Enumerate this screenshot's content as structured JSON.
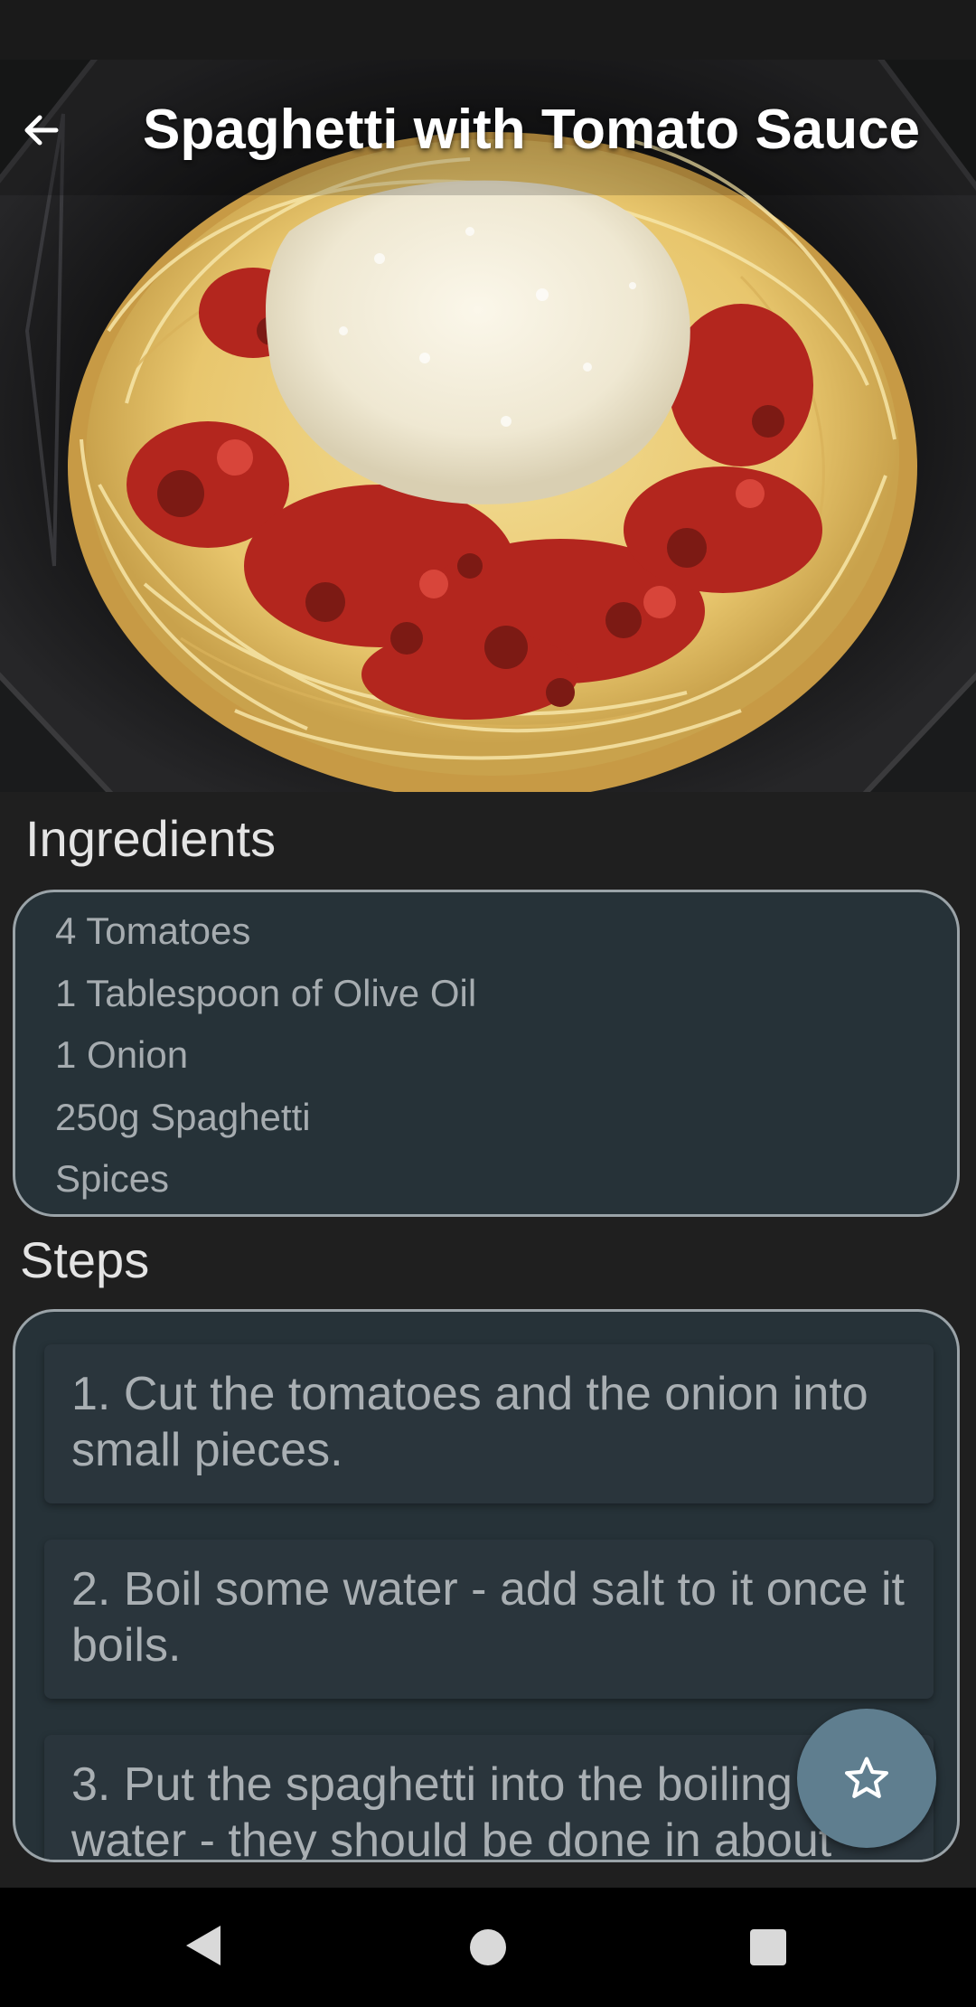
{
  "app": {
    "title": "Spaghetti with Tomato Sauce"
  },
  "icons": {
    "back": "arrow-left-icon",
    "favorite": "star-outline-icon",
    "nav_back": "triangle-back-icon",
    "nav_home": "circle-home-icon",
    "nav_recents": "square-recents-icon"
  },
  "ingredients": {
    "title": "Ingredients",
    "items": [
      "4 Tomatoes",
      "1 Tablespoon of Olive Oil",
      "1 Onion",
      "250g Spaghetti",
      "Spices"
    ]
  },
  "steps": {
    "title": "Steps",
    "items": [
      "1.  Cut the tomatoes and the onion into small pieces.",
      "2.  Boil some water - add salt to it once it boils.",
      "3.  Put the spaghetti into the boiling water - they should be done in about"
    ]
  },
  "colors": {
    "background": "#1f1f1f",
    "card": "#263238",
    "card_border": "#9aa3a8",
    "fab": "#5f7e8f",
    "text_primary": "#e4e4e4",
    "text_secondary": "#a6acb0"
  }
}
